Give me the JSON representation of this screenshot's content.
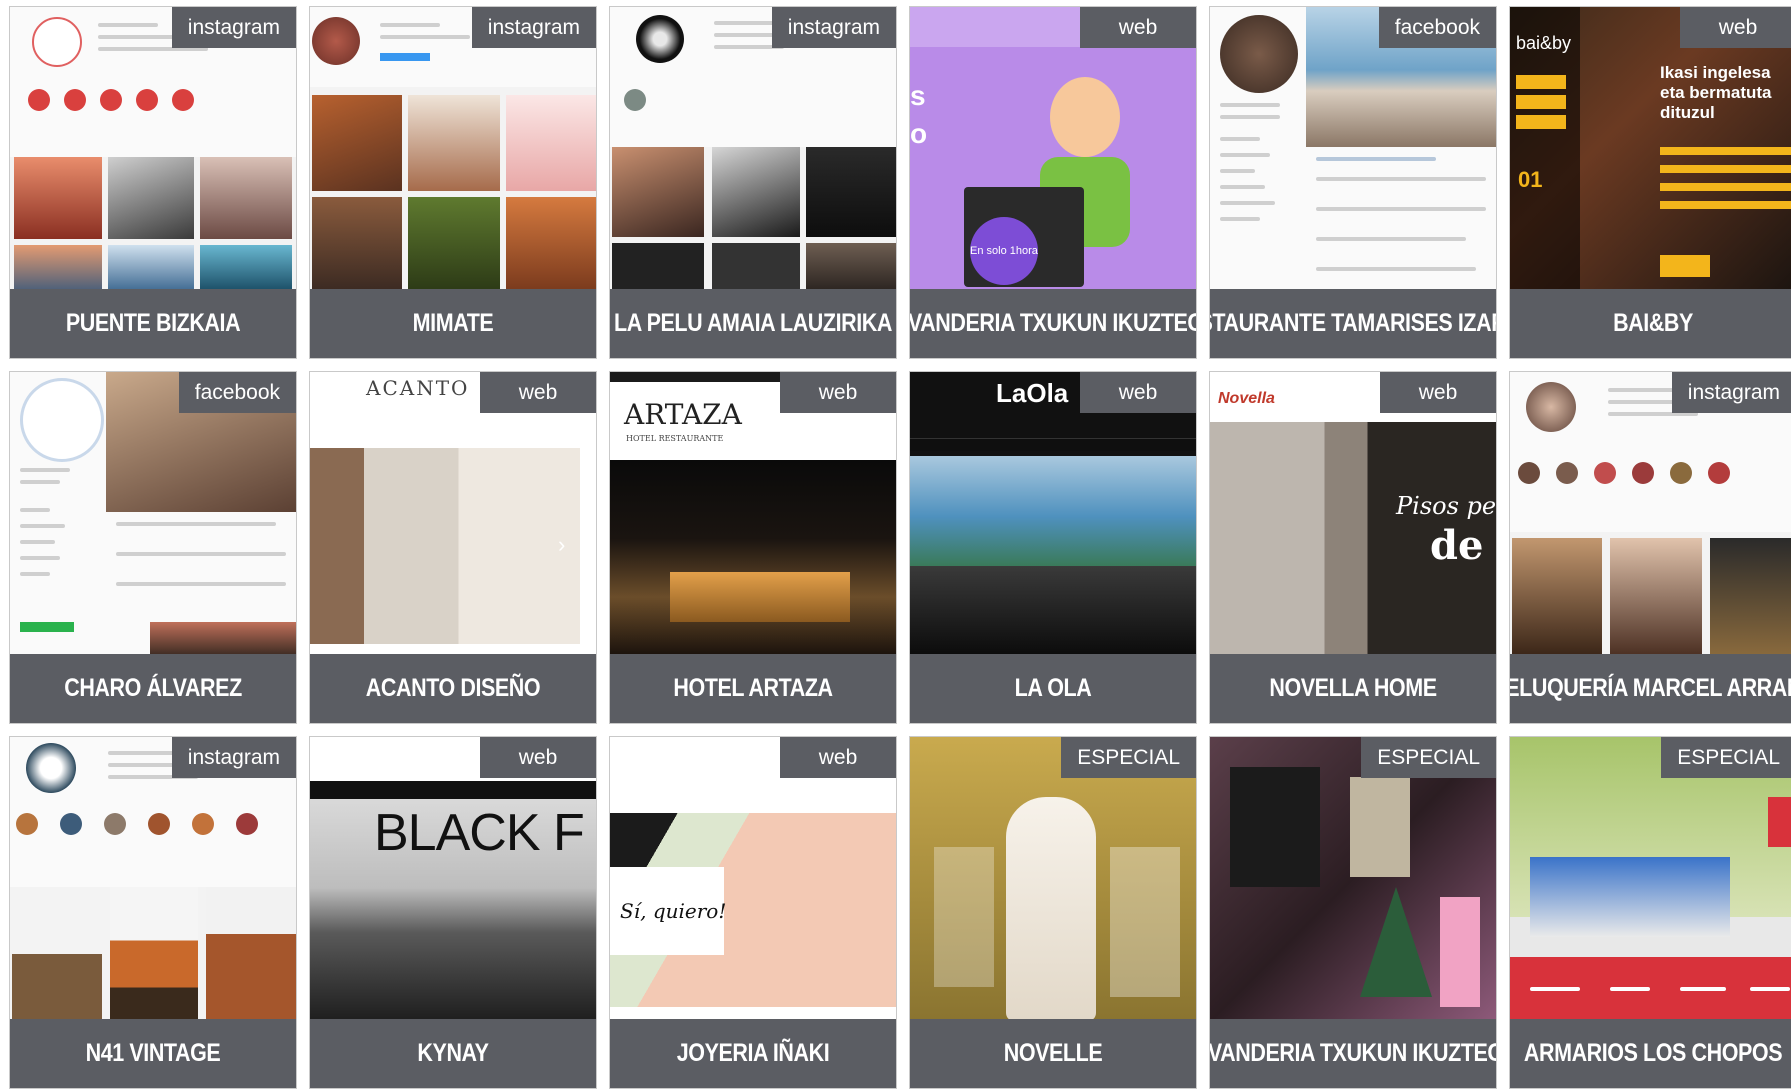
{
  "cards": [
    {
      "title": "PUENTE BIZKAIA",
      "tag": "instagram"
    },
    {
      "title": "MIMATE",
      "tag": "instagram"
    },
    {
      "title": "LA PELU AMAIA LAUZIRIKA",
      "tag": "instagram"
    },
    {
      "title": "LAVANDERIA TXUKUN IKUZTEGIA",
      "tag": "web"
    },
    {
      "title": "RESTAURANTE TAMARISES IZARRA",
      "tag": "facebook"
    },
    {
      "title": "BAI&BY",
      "tag": "web"
    },
    {
      "title": "CHARO ÁLVAREZ",
      "tag": "facebook"
    },
    {
      "title": "ACANTO DISEÑO",
      "tag": "web"
    },
    {
      "title": "HOTEL ARTAZA",
      "tag": "web"
    },
    {
      "title": "LA OLA",
      "tag": "web"
    },
    {
      "title": "NOVELLA HOME",
      "tag": "web"
    },
    {
      "title": "PELUQUERÍA MARCEL ARRANZ",
      "tag": "instagram"
    },
    {
      "title": "N41 VINTAGE",
      "tag": "instagram"
    },
    {
      "title": "KYNAY",
      "tag": "web"
    },
    {
      "title": "JOYERIA IÑAKI",
      "tag": "web"
    },
    {
      "title": "NOVELLE",
      "tag": "ESPECIAL"
    },
    {
      "title": "LAVANDERIA TXUKUN IKUZTEGIA",
      "tag": "ESPECIAL"
    },
    {
      "title": "ARMARIOS LOS CHOPOS",
      "tag": "ESPECIAL"
    }
  ],
  "thumb_text": {
    "acanto_logo": "ACANTO",
    "artaza_logo": "ARTAZA",
    "artaza_sub": "HOTEL RESTAURANTE",
    "laola_logo": "LaOla",
    "novella_logo": "Novella",
    "novella_script": "Pisos peq",
    "novella_big": "de",
    "kynay_big": "BLACK F",
    "joyeria_script": "Sí, quiero!",
    "baiby_logo": "bai&by",
    "baiby_head": "Ikasi ingelesa eta bermatuta dituzul",
    "baiby_num": "01",
    "lavanderia_badge": "En solo 1hora",
    "lavanderia_side": "s o"
  },
  "colors": {
    "caption_bg": "#5b5d63",
    "tag_bg": "#5b5d63",
    "caption_text": "#ffffff",
    "card_border": "#c9c9c9",
    "lavanderia_purple": "#b98be8",
    "baiby_yellow": "#f3b51b",
    "chopos_red": "#d8323b"
  },
  "icons": {
    "instagram_story": "circle-icon",
    "next_arrow": "chevron-right-icon"
  }
}
